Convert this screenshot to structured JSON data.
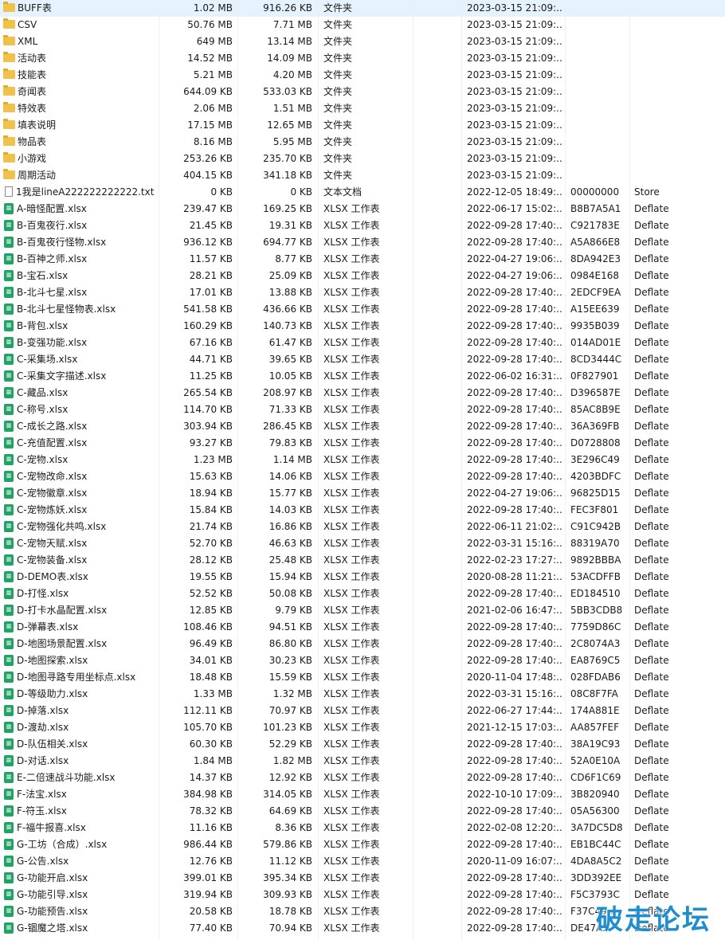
{
  "type_labels": {
    "folder": "文件夹",
    "text": "文本文档",
    "xlsx": "XLSX 工作表"
  },
  "icons": {
    "folder": "folder-icon",
    "text": "text-file-icon",
    "xlsx": "xlsx-file-icon"
  },
  "files": [
    {
      "name": "BUFF表",
      "size": "1.02 MB",
      "packed": "916.26 KB",
      "kind": "folder",
      "modified": "2023-03-15 21:09:...",
      "crc": "",
      "method": ""
    },
    {
      "name": "CSV",
      "size": "50.76 MB",
      "packed": "7.71 MB",
      "kind": "folder",
      "modified": "2023-03-15 21:09:...",
      "crc": "",
      "method": ""
    },
    {
      "name": "XML",
      "size": "649 MB",
      "packed": "13.14 MB",
      "kind": "folder",
      "modified": "2023-03-15 21:09:...",
      "crc": "",
      "method": ""
    },
    {
      "name": "活动表",
      "size": "14.52 MB",
      "packed": "14.09 MB",
      "kind": "folder",
      "modified": "2023-03-15 21:09:...",
      "crc": "",
      "method": ""
    },
    {
      "name": "技能表",
      "size": "5.21 MB",
      "packed": "4.20 MB",
      "kind": "folder",
      "modified": "2023-03-15 21:09:...",
      "crc": "",
      "method": ""
    },
    {
      "name": "奇闻表",
      "size": "644.09 KB",
      "packed": "533.03 KB",
      "kind": "folder",
      "modified": "2023-03-15 21:09:...",
      "crc": "",
      "method": ""
    },
    {
      "name": "特效表",
      "size": "2.06 MB",
      "packed": "1.51 MB",
      "kind": "folder",
      "modified": "2023-03-15 21:09:...",
      "crc": "",
      "method": ""
    },
    {
      "name": "填表说明",
      "size": "17.15 MB",
      "packed": "12.65 MB",
      "kind": "folder",
      "modified": "2023-03-15 21:09:...",
      "crc": "",
      "method": ""
    },
    {
      "name": "物品表",
      "size": "8.16 MB",
      "packed": "5.95 MB",
      "kind": "folder",
      "modified": "2023-03-15 21:09:...",
      "crc": "",
      "method": ""
    },
    {
      "name": "小游戏",
      "size": "253.26 KB",
      "packed": "235.70 KB",
      "kind": "folder",
      "modified": "2023-03-15 21:09:...",
      "crc": "",
      "method": ""
    },
    {
      "name": "周期活动",
      "size": "404.15 KB",
      "packed": "341.18 KB",
      "kind": "folder",
      "modified": "2023-03-15 21:09:...",
      "crc": "",
      "method": ""
    },
    {
      "name": "1我是lineA222222222222.txt",
      "size": "0 KB",
      "packed": "0 KB",
      "kind": "text",
      "modified": "2022-12-05 18:49:...",
      "crc": "00000000",
      "method": "Store"
    },
    {
      "name": "A-暗怪配置.xlsx",
      "size": "239.47 KB",
      "packed": "169.25 KB",
      "kind": "xlsx",
      "modified": "2022-06-17 15:02:...",
      "crc": "B8B7A5A1",
      "method": "Deflate"
    },
    {
      "name": "B-百鬼夜行.xlsx",
      "size": "21.45 KB",
      "packed": "19.31 KB",
      "kind": "xlsx",
      "modified": "2022-09-28 17:40:...",
      "crc": "C921783E",
      "method": "Deflate"
    },
    {
      "name": "B-百鬼夜行怪物.xlsx",
      "size": "936.12 KB",
      "packed": "694.77 KB",
      "kind": "xlsx",
      "modified": "2022-09-28 17:40:...",
      "crc": "A5A866E8",
      "method": "Deflate"
    },
    {
      "name": "B-百神之师.xlsx",
      "size": "11.57 KB",
      "packed": "8.77 KB",
      "kind": "xlsx",
      "modified": "2022-04-27 19:06:...",
      "crc": "8DA942E3",
      "method": "Deflate"
    },
    {
      "name": "B-宝石.xlsx",
      "size": "28.21 KB",
      "packed": "25.09 KB",
      "kind": "xlsx",
      "modified": "2022-04-27 19:06:...",
      "crc": "0984E168",
      "method": "Deflate"
    },
    {
      "name": "B-北斗七星.xlsx",
      "size": "17.01 KB",
      "packed": "13.88 KB",
      "kind": "xlsx",
      "modified": "2022-09-28 17:40:...",
      "crc": "2EDCF9EA",
      "method": "Deflate"
    },
    {
      "name": "B-北斗七星怪物表.xlsx",
      "size": "541.58 KB",
      "packed": "436.66 KB",
      "kind": "xlsx",
      "modified": "2022-09-28 17:40:...",
      "crc": "A15EE639",
      "method": "Deflate"
    },
    {
      "name": "B-背包.xlsx",
      "size": "160.29 KB",
      "packed": "140.73 KB",
      "kind": "xlsx",
      "modified": "2022-09-28 17:40:...",
      "crc": "9935B039",
      "method": "Deflate"
    },
    {
      "name": "B-变强功能.xlsx",
      "size": "67.16 KB",
      "packed": "61.47 KB",
      "kind": "xlsx",
      "modified": "2022-09-28 17:40:...",
      "crc": "014AD01E",
      "method": "Deflate"
    },
    {
      "name": "C-采集场.xlsx",
      "size": "44.71 KB",
      "packed": "39.65 KB",
      "kind": "xlsx",
      "modified": "2022-09-28 17:40:...",
      "crc": "8CD3444C",
      "method": "Deflate"
    },
    {
      "name": "C-采集文字描述.xlsx",
      "size": "11.25 KB",
      "packed": "10.05 KB",
      "kind": "xlsx",
      "modified": "2022-06-02 16:31:...",
      "crc": "0F827901",
      "method": "Deflate"
    },
    {
      "name": "C-藏品.xlsx",
      "size": "265.54 KB",
      "packed": "208.97 KB",
      "kind": "xlsx",
      "modified": "2022-09-28 17:40:...",
      "crc": "D396587E",
      "method": "Deflate"
    },
    {
      "name": "C-称号.xlsx",
      "size": "114.70 KB",
      "packed": "71.33 KB",
      "kind": "xlsx",
      "modified": "2022-09-28 17:40:...",
      "crc": "85AC8B9E",
      "method": "Deflate"
    },
    {
      "name": "C-成长之路.xlsx",
      "size": "303.94 KB",
      "packed": "286.45 KB",
      "kind": "xlsx",
      "modified": "2022-09-28 17:40:...",
      "crc": "36A369FB",
      "method": "Deflate"
    },
    {
      "name": "C-充值配置.xlsx",
      "size": "93.27 KB",
      "packed": "79.83 KB",
      "kind": "xlsx",
      "modified": "2022-09-28 17:40:...",
      "crc": "D0728808",
      "method": "Deflate"
    },
    {
      "name": "C-宠物.xlsx",
      "size": "1.23 MB",
      "packed": "1.14 MB",
      "kind": "xlsx",
      "modified": "2022-09-28 17:40:...",
      "crc": "3E296C49",
      "method": "Deflate"
    },
    {
      "name": "C-宠物改命.xlsx",
      "size": "15.63 KB",
      "packed": "14.06 KB",
      "kind": "xlsx",
      "modified": "2022-09-28 17:40:...",
      "crc": "4203BDFC",
      "method": "Deflate"
    },
    {
      "name": "C-宠物徽章.xlsx",
      "size": "18.94 KB",
      "packed": "15.77 KB",
      "kind": "xlsx",
      "modified": "2022-04-27 19:06:...",
      "crc": "96825D15",
      "method": "Deflate"
    },
    {
      "name": "C-宠物炼妖.xlsx",
      "size": "15.84 KB",
      "packed": "14.03 KB",
      "kind": "xlsx",
      "modified": "2022-09-28 17:40:...",
      "crc": "FEC3F801",
      "method": "Deflate"
    },
    {
      "name": "C-宠物强化共鸣.xlsx",
      "size": "21.74 KB",
      "packed": "16.86 KB",
      "kind": "xlsx",
      "modified": "2022-06-11 21:02:...",
      "crc": "C91C942B",
      "method": "Deflate"
    },
    {
      "name": "C-宠物天赋.xlsx",
      "size": "52.70 KB",
      "packed": "46.63 KB",
      "kind": "xlsx",
      "modified": "2022-03-31 15:16:...",
      "crc": "88319A70",
      "method": "Deflate"
    },
    {
      "name": "C-宠物装备.xlsx",
      "size": "28.12 KB",
      "packed": "25.48 KB",
      "kind": "xlsx",
      "modified": "2022-02-23 17:27:...",
      "crc": "9892BBBA",
      "method": "Deflate"
    },
    {
      "name": "D-DEMO表.xlsx",
      "size": "19.55 KB",
      "packed": "15.94 KB",
      "kind": "xlsx",
      "modified": "2020-08-28 11:21:...",
      "crc": "53ACDFFB",
      "method": "Deflate"
    },
    {
      "name": "D-打怪.xlsx",
      "size": "52.52 KB",
      "packed": "50.08 KB",
      "kind": "xlsx",
      "modified": "2022-09-28 17:40:...",
      "crc": "ED184510",
      "method": "Deflate"
    },
    {
      "name": "D-打卡水晶配置.xlsx",
      "size": "12.85 KB",
      "packed": "9.79 KB",
      "kind": "xlsx",
      "modified": "2021-02-06 16:47:...",
      "crc": "5BB3CDB8",
      "method": "Deflate"
    },
    {
      "name": "D-弹幕表.xlsx",
      "size": "108.46 KB",
      "packed": "94.51 KB",
      "kind": "xlsx",
      "modified": "2022-09-28 17:40:...",
      "crc": "7759D86C",
      "method": "Deflate"
    },
    {
      "name": "D-地图场景配置.xlsx",
      "size": "96.49 KB",
      "packed": "86.80 KB",
      "kind": "xlsx",
      "modified": "2022-09-28 17:40:...",
      "crc": "2C8074A3",
      "method": "Deflate"
    },
    {
      "name": "D-地图探索.xlsx",
      "size": "34.01 KB",
      "packed": "30.23 KB",
      "kind": "xlsx",
      "modified": "2022-09-28 17:40:...",
      "crc": "EA8769C5",
      "method": "Deflate"
    },
    {
      "name": "D-地图寻路专用坐标点.xlsx",
      "size": "18.48 KB",
      "packed": "15.59 KB",
      "kind": "xlsx",
      "modified": "2020-11-04 17:48:...",
      "crc": "028FDAB6",
      "method": "Deflate"
    },
    {
      "name": "D-等级助力.xlsx",
      "size": "1.33 MB",
      "packed": "1.32 MB",
      "kind": "xlsx",
      "modified": "2022-03-31 15:16:...",
      "crc": "08C8F7FA",
      "method": "Deflate"
    },
    {
      "name": "D-掉落.xlsx",
      "size": "112.11 KB",
      "packed": "70.97 KB",
      "kind": "xlsx",
      "modified": "2022-06-27 17:44:...",
      "crc": "174A881E",
      "method": "Deflate"
    },
    {
      "name": "D-渡劫.xlsx",
      "size": "105.70 KB",
      "packed": "101.23 KB",
      "kind": "xlsx",
      "modified": "2021-12-15 17:03:...",
      "crc": "AA857FEF",
      "method": "Deflate"
    },
    {
      "name": "D-队伍相关.xlsx",
      "size": "60.30 KB",
      "packed": "52.29 KB",
      "kind": "xlsx",
      "modified": "2022-09-28 17:40:...",
      "crc": "38A19C93",
      "method": "Deflate"
    },
    {
      "name": "D-对话.xlsx",
      "size": "1.84 MB",
      "packed": "1.82 MB",
      "kind": "xlsx",
      "modified": "2022-09-28 17:40:...",
      "crc": "52A0E10A",
      "method": "Deflate"
    },
    {
      "name": "E-二倍速战斗功能.xlsx",
      "size": "14.37 KB",
      "packed": "12.92 KB",
      "kind": "xlsx",
      "modified": "2022-09-28 17:40:...",
      "crc": "CD6F1C69",
      "method": "Deflate"
    },
    {
      "name": "F-法宝.xlsx",
      "size": "384.98 KB",
      "packed": "314.05 KB",
      "kind": "xlsx",
      "modified": "2022-10-10 17:09:...",
      "crc": "3B820940",
      "method": "Deflate"
    },
    {
      "name": "F-符玉.xlsx",
      "size": "78.32 KB",
      "packed": "64.69 KB",
      "kind": "xlsx",
      "modified": "2022-09-28 17:40:...",
      "crc": "05A56300",
      "method": "Deflate"
    },
    {
      "name": "F-福牛报喜.xlsx",
      "size": "11.16 KB",
      "packed": "8.36 KB",
      "kind": "xlsx",
      "modified": "2022-02-08 12:20:...",
      "crc": "3A7DC5D8",
      "method": "Deflate"
    },
    {
      "name": "G-工坊（合成）.xlsx",
      "size": "986.44 KB",
      "packed": "579.86 KB",
      "kind": "xlsx",
      "modified": "2022-09-28 17:40:...",
      "crc": "EB1BC44C",
      "method": "Deflate"
    },
    {
      "name": "G-公告.xlsx",
      "size": "12.76 KB",
      "packed": "11.12 KB",
      "kind": "xlsx",
      "modified": "2020-11-09 16:07:...",
      "crc": "4DA8A5C2",
      "method": "Deflate"
    },
    {
      "name": "G-功能开启.xlsx",
      "size": "399.01 KB",
      "packed": "395.34 KB",
      "kind": "xlsx",
      "modified": "2022-09-28 17:40:...",
      "crc": "3DD392EE",
      "method": "Deflate"
    },
    {
      "name": "G-功能引导.xlsx",
      "size": "319.94 KB",
      "packed": "309.93 KB",
      "kind": "xlsx",
      "modified": "2022-09-28 17:40:...",
      "crc": "F5C3793C",
      "method": "Deflate"
    },
    {
      "name": "G-功能预告.xlsx",
      "size": "20.58 KB",
      "packed": "18.78 KB",
      "kind": "xlsx",
      "modified": "2022-09-28 17:40:...",
      "crc": "F37C49..",
      "method": "Deflate"
    },
    {
      "name": "G-锢魔之塔.xlsx",
      "size": "77.40 KB",
      "packed": "70.94 KB",
      "kind": "xlsx",
      "modified": "2022-09-28 17:40:...",
      "crc": "DE47A..",
      "method": "Deflate"
    }
  ],
  "watermark": "破走论坛"
}
